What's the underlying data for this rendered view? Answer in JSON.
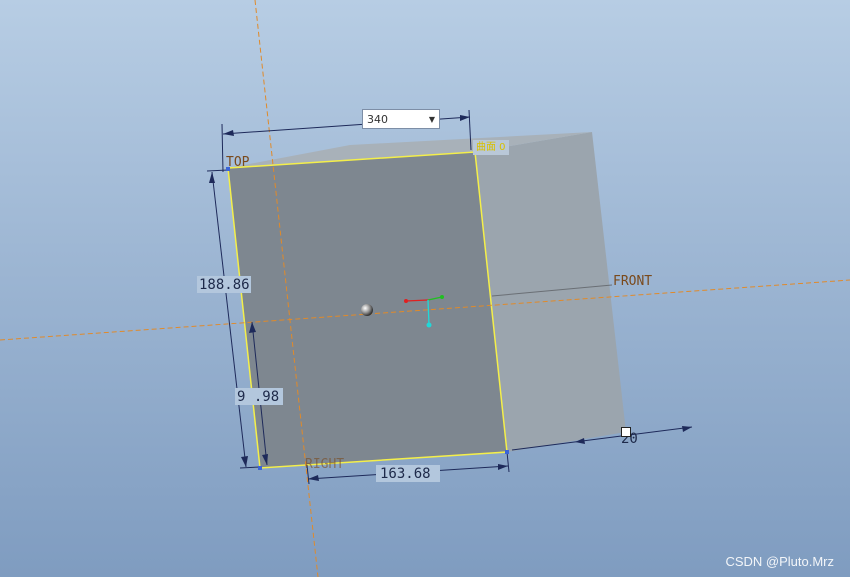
{
  "viewport": {
    "datum_planes": {
      "top": "TOP",
      "front": "FRONT",
      "right": "RIGHT"
    }
  },
  "dimensions": {
    "input_value": "340",
    "height": "188.86",
    "partial_height": "9 .98",
    "width": "163.68",
    "depth": "20"
  },
  "face_tag": "曲面 0",
  "watermark": "CSDN @Pluto.Mrz",
  "colors": {
    "background_top": "#b7cde4",
    "background_bottom": "#7f9cc0",
    "front_face": "#7e8790",
    "side_face": "#9ba5ae",
    "highlight": "#f4ef4a",
    "datum_axis": "#e08a2a",
    "dimension_line": "#1e2a5a"
  }
}
